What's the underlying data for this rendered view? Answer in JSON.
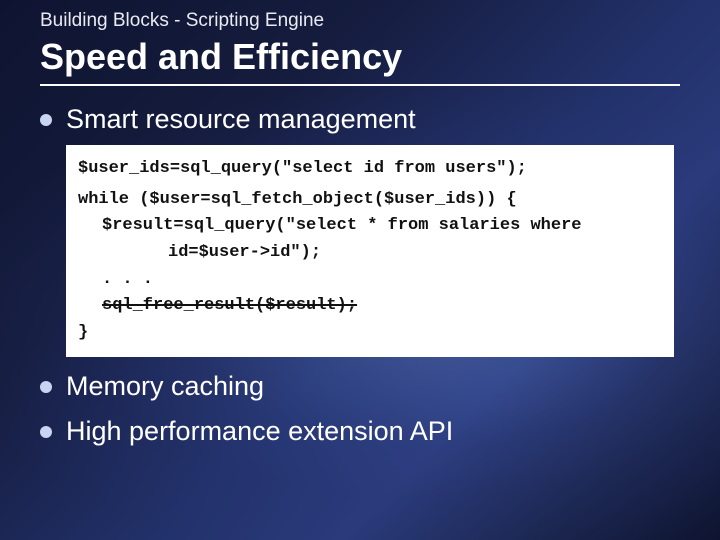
{
  "header": {
    "kicker": "Building Blocks - Scripting Engine",
    "title": "Speed and Efficiency"
  },
  "bullets": {
    "b1": "Smart resource management",
    "b2": "Memory caching",
    "b3": "High performance extension API"
  },
  "code": {
    "l1": "$user_ids=sql_query(\"select id from users\");",
    "l2": "while ($user=sql_fetch_object($user_ids)) {",
    "l3a": "$result=sql_query(\"select * from salaries where",
    "l3b": "id=$user->id\");",
    "l4": ". . .",
    "l5": "sql_free_result($result);",
    "l6": "}"
  }
}
